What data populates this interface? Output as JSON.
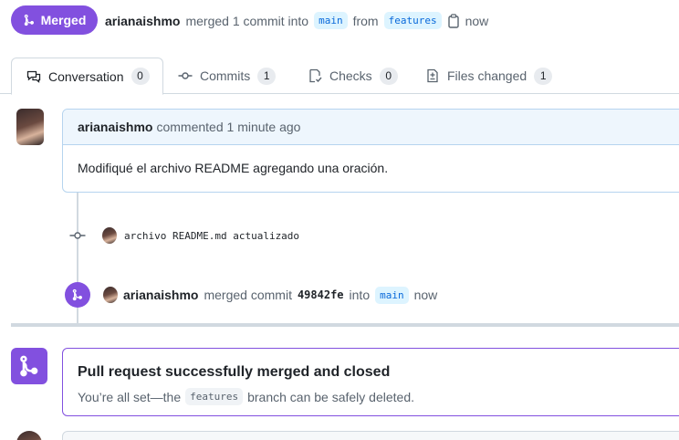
{
  "header": {
    "status_label": "Merged",
    "author": "arianaishmo",
    "merged_text": "merged 1 commit into",
    "base_branch": "main",
    "from_text": "from",
    "head_branch": "features",
    "time": "now"
  },
  "tabs": [
    {
      "label": "Conversation",
      "count": "0",
      "icon": "comment-discussion-icon",
      "active": true
    },
    {
      "label": "Commits",
      "count": "1",
      "icon": "git-commit-icon",
      "active": false
    },
    {
      "label": "Checks",
      "count": "0",
      "icon": "checklist-icon",
      "active": false
    },
    {
      "label": "Files changed",
      "count": "1",
      "icon": "file-diff-icon",
      "active": false
    }
  ],
  "comment": {
    "author": "arianaishmo",
    "action": "commented 1 minute ago",
    "body": "Modifiqué el archivo README agregando una oración."
  },
  "commit": {
    "message": "archivo README.md actualizado"
  },
  "merge_event": {
    "author": "arianaishmo",
    "text": "merged commit",
    "sha": "49842fe",
    "into_text": "into",
    "branch": "main",
    "time": "now"
  },
  "merged_notice": {
    "title": "Pull request successfully merged and closed",
    "desc_prefix": "You’re all set—the",
    "branch": "features",
    "desc_suffix": "branch can be safely deleted."
  },
  "colors": {
    "merged_purple": "#8250df",
    "branch_bg": "#ddf4ff",
    "branch_text": "#0969da"
  }
}
